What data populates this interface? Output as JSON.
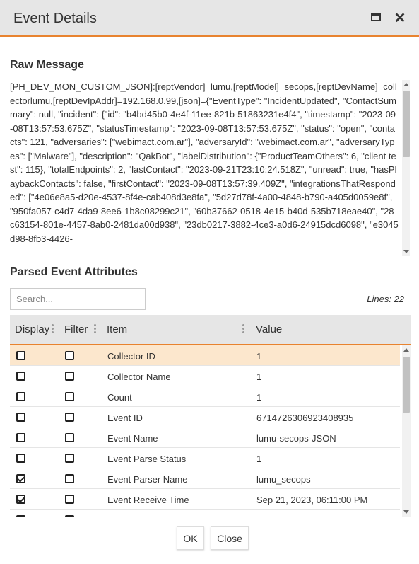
{
  "window": {
    "title": "Event Details",
    "maximize_icon": "window-maximize-icon",
    "close_icon": "close-icon",
    "close_glyph": "✕"
  },
  "raw_message": {
    "heading": "Raw Message",
    "text": "[PH_DEV_MON_CUSTOM_JSON]:[reptVendor]=lumu,[reptModel]=secops,[reptDevName]=collectorlumu,[reptDevIpAddr]=192.168.0.99,[json]={\"EventType\": \"IncidentUpdated\", \"ContactSummary\": null, \"incident\": {\"id\": \"b4bd45b0-4e4f-11ee-821b-51863231e4f4\", \"timestamp\": \"2023-09-08T13:57:53.675Z\", \"statusTimestamp\": \"2023-09-08T13:57:53.675Z\", \"status\": \"open\", \"contacts\": 121, \"adversaries\": [\"webimact.com.ar\"], \"adversaryId\": \"webimact.com.ar\", \"adversaryTypes\": [\"Malware\"], \"description\": \"QakBot\", \"labelDistribution\": {\"ProductTeamOthers\": 6, \"client test\": 115}, \"totalEndpoints\": 2, \"lastContact\": \"2023-09-21T23:10:24.518Z\", \"unread\": true, \"hasPlaybackContacts\": false, \"firstContact\": \"2023-09-08T13:57:39.409Z\", \"integrationsThatResponded\": [\"4e06e8a5-d20e-4537-8f4e-cab408d3e8fa\", \"5d27d78f-4a00-4848-b790-a405d0059e8f\", \"950fa057-c4d7-4da9-8ee6-1b8c08299c21\", \"60b37662-0518-4e15-b40d-535b718eae40\", \"28c63154-801e-4457-8ab0-2481da00d938\", \"23db0217-3882-4ce3-a0d6-24915dcd6098\", \"e3045d98-8fb3-4426-"
  },
  "parsed": {
    "heading": "Parsed Event Attributes",
    "search_placeholder": "Search...",
    "lines_label": "Lines: 22",
    "columns": {
      "display": "Display",
      "filter": "Filter",
      "item": "Item",
      "value": "Value"
    },
    "rows": [
      {
        "item": "Collector ID",
        "value": "1",
        "display": false,
        "filter": false,
        "selected": true
      },
      {
        "item": "Collector Name",
        "value": "1",
        "display": false,
        "filter": false
      },
      {
        "item": "Count",
        "value": "1",
        "display": false,
        "filter": false
      },
      {
        "item": "Event ID",
        "value": "6714726306923408935",
        "display": false,
        "filter": false
      },
      {
        "item": "Event Name",
        "value": "lumu-secops-JSON",
        "display": false,
        "filter": false
      },
      {
        "item": "Event Parse Status",
        "value": "1",
        "display": false,
        "filter": false
      },
      {
        "item": "Event Parser Name",
        "value": "lumu_secops",
        "display": true,
        "filter": false
      },
      {
        "item": "Event Receive Time",
        "value": "Sep 21, 2023, 06:11:00 PM",
        "display": true,
        "filter": false
      },
      {
        "item": "",
        "value": "",
        "display": false,
        "filter": false
      }
    ]
  },
  "buttons": {
    "ok": "OK",
    "close": "Close"
  },
  "colors": {
    "accent": "#e8832f",
    "header_bg": "#e6e6e6",
    "selected_row": "#fce7cd"
  }
}
